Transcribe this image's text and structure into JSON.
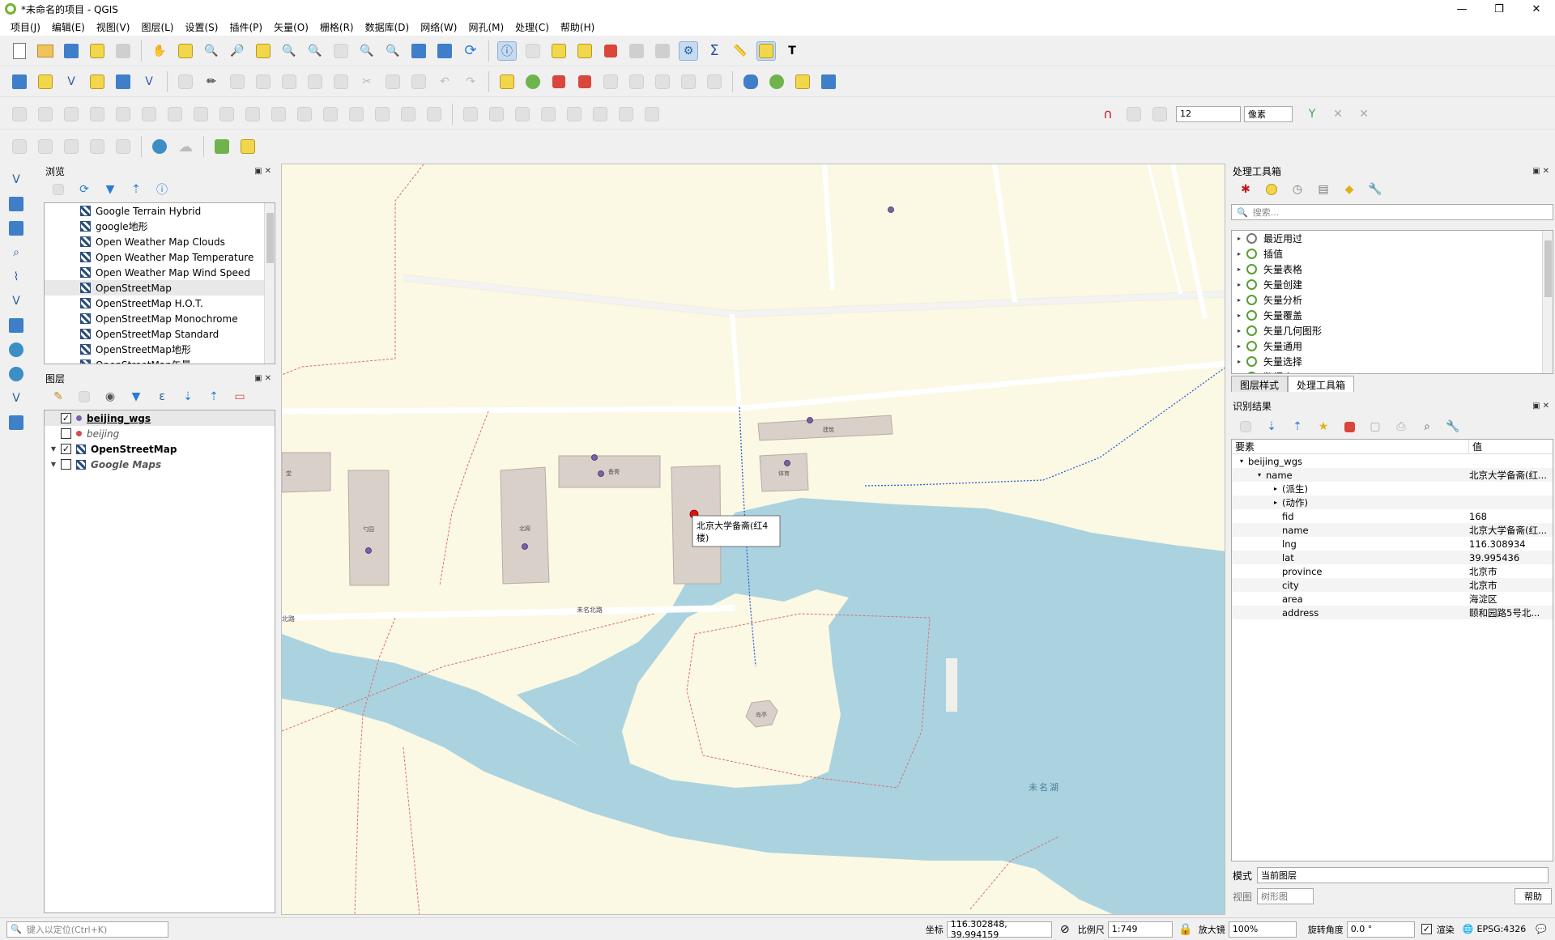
{
  "window": {
    "title": "*未命名的项目 - QGIS",
    "min": "—",
    "max": "❐",
    "close": "✕"
  },
  "menu": [
    "项目(J)",
    "编辑(E)",
    "视图(V)",
    "图层(L)",
    "设置(S)",
    "插件(P)",
    "矢量(O)",
    "栅格(R)",
    "数据库(D)",
    "网络(W)",
    "网孔(M)",
    "处理(C)",
    "帮助(H)"
  ],
  "snapping": {
    "tolerance": "12",
    "unit": "像素"
  },
  "browser": {
    "title": "浏览",
    "items": [
      "Google Terrain Hybrid",
      "google地形",
      "Open Weather Map Clouds",
      "Open Weather Map Temperature",
      "Open Weather Map Wind Speed",
      "OpenStreetMap",
      "OpenStreetMap H.O.T.",
      "OpenStreetMap Monochrome",
      "OpenStreetMap Standard",
      "OpenStreetMap地形",
      "OpenStreetMap矢量"
    ],
    "selected_index": 5
  },
  "layers": {
    "title": "图层",
    "items": [
      {
        "name": "beijing_wgs",
        "checked": true,
        "bold": true,
        "underline": true,
        "italic": false,
        "color": "#7b61a8"
      },
      {
        "name": "beijing",
        "checked": false,
        "bold": false,
        "italic": true,
        "color": "#d94a4a"
      },
      {
        "name": "OpenStreetMap",
        "checked": true,
        "bold": true,
        "italic": false
      },
      {
        "name": "Google Maps",
        "checked": false,
        "bold": true,
        "italic": true
      }
    ]
  },
  "processing": {
    "title": "处理工具箱",
    "search_placeholder": "搜索...",
    "items": [
      "最近用过",
      "插值",
      "矢量表格",
      "矢量创建",
      "矢量分析",
      "矢量覆盖",
      "矢量几何图形",
      "矢量通用",
      "矢量选择",
      "数据库"
    ],
    "tabs": [
      "图层样式",
      "处理工具箱"
    ],
    "active_tab": 1
  },
  "identify": {
    "title": "识别结果",
    "col_feature": "要素",
    "col_value": "值",
    "layer": "beijing_wgs",
    "feature_field": "name",
    "feature_value": "北京大学备斋(红...",
    "groups": [
      "(派生)",
      "(动作)"
    ],
    "attrs": [
      {
        "k": "fid",
        "v": "168"
      },
      {
        "k": "name",
        "v": "北京大学备斋(红..."
      },
      {
        "k": "lng",
        "v": "116.308934"
      },
      {
        "k": "lat",
        "v": "39.995436"
      },
      {
        "k": "province",
        "v": "北京市"
      },
      {
        "k": "city",
        "v": "北京市"
      },
      {
        "k": "area",
        "v": "海淀区"
      },
      {
        "k": "address",
        "v": "颐和园路5号北..."
      }
    ],
    "mode_label": "模式",
    "mode_value": "当前图层",
    "view_label": "视图",
    "view_value": "树形图",
    "help": "帮助"
  },
  "map": {
    "tooltip": [
      "北京大学备斋(红4",
      "楼)"
    ],
    "road_label": "未名北路",
    "road_label_left": "北路",
    "lake_label": "未名湖",
    "island_label": "岛亭",
    "building_labels": [
      "建筑",
      "备斋",
      "体育",
      "北阁",
      "勺园",
      "堂"
    ],
    "colors": {
      "land": "#fbf8e3",
      "water": "#aad3df",
      "building": "#d9d0c9",
      "road": "#ffffff",
      "boundary": "#d97070",
      "path": "#2a5fd6",
      "point": "#7b61a8",
      "selected": "#e01010"
    }
  },
  "status": {
    "locator_placeholder": "键入以定位(Ctrl+K)",
    "coord_label": "坐标",
    "coord_value": "116.302848, 39.994159",
    "scale_label": "比例尺",
    "scale_value": "1:749",
    "magnifier_label": "放大镜",
    "magnifier_value": "100%",
    "rotation_label": "旋转角度",
    "rotation_value": "0.0 °",
    "render_label": "渲染",
    "crs": "EPSG:4326"
  }
}
